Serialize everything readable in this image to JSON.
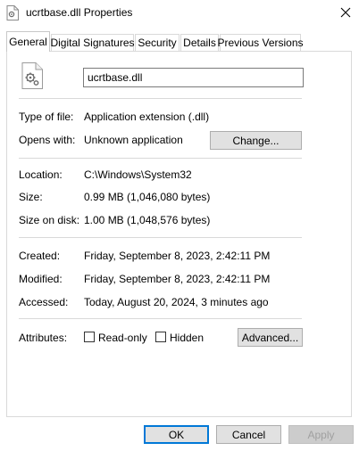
{
  "window": {
    "title": "ucrtbase.dll Properties"
  },
  "tabs": [
    {
      "label": "General",
      "active": true
    },
    {
      "label": "Digital Signatures",
      "active": false
    },
    {
      "label": "Security",
      "active": false
    },
    {
      "label": "Details",
      "active": false
    },
    {
      "label": "Previous Versions",
      "active": false
    }
  ],
  "general": {
    "file_name": "ucrtbase.dll",
    "type_of_file": {
      "label": "Type of file:",
      "value": "Application extension (.dll)"
    },
    "opens_with": {
      "label": "Opens with:",
      "value": "Unknown application",
      "change_label": "Change..."
    },
    "location": {
      "label": "Location:",
      "value": "C:\\Windows\\System32"
    },
    "size": {
      "label": "Size:",
      "value": "0.99 MB (1,046,080 bytes)"
    },
    "size_on_disk": {
      "label": "Size on disk:",
      "value": "1.00 MB (1,048,576 bytes)"
    },
    "created": {
      "label": "Created:",
      "value": "Friday, September 8, 2023, 2:42:11 PM"
    },
    "modified": {
      "label": "Modified:",
      "value": "Friday, September 8, 2023, 2:42:11 PM"
    },
    "accessed": {
      "label": "Accessed:",
      "value": "Today, August 20, 2024, 3 minutes ago"
    },
    "attributes": {
      "label": "Attributes:",
      "read_only": {
        "label": "Read-only",
        "checked": false
      },
      "hidden": {
        "label": "Hidden",
        "checked": false
      },
      "advanced_label": "Advanced..."
    }
  },
  "footer": {
    "ok_label": "OK",
    "cancel_label": "Cancel",
    "apply_label": "Apply"
  },
  "colors": {
    "accent": "#0078d7",
    "border": "#d9d9d9",
    "button_bg": "#e1e1e1",
    "disabled_text": "#a0a0a0"
  },
  "icons": {
    "title": "dll-file-icon",
    "close": "close-icon",
    "file": "dll-gear-file-icon"
  }
}
